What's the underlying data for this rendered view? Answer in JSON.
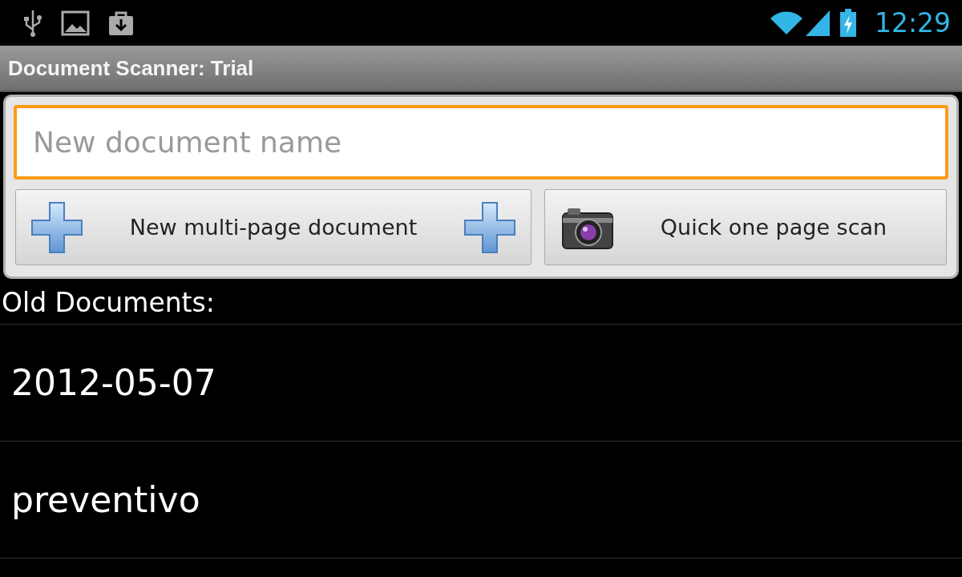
{
  "status_bar": {
    "time": "12:29"
  },
  "title_bar": {
    "title": "Document Scanner: Trial"
  },
  "name_field": {
    "placeholder": "New document name",
    "focused": true
  },
  "buttons": [
    {
      "kind": "multi",
      "label": "New multi-page document"
    },
    {
      "kind": "quick",
      "label": "Quick one page scan"
    }
  ],
  "section_label": "Old Documents:",
  "documents": [
    {
      "name": "2012-05-07"
    },
    {
      "name": "preventivo"
    }
  ]
}
